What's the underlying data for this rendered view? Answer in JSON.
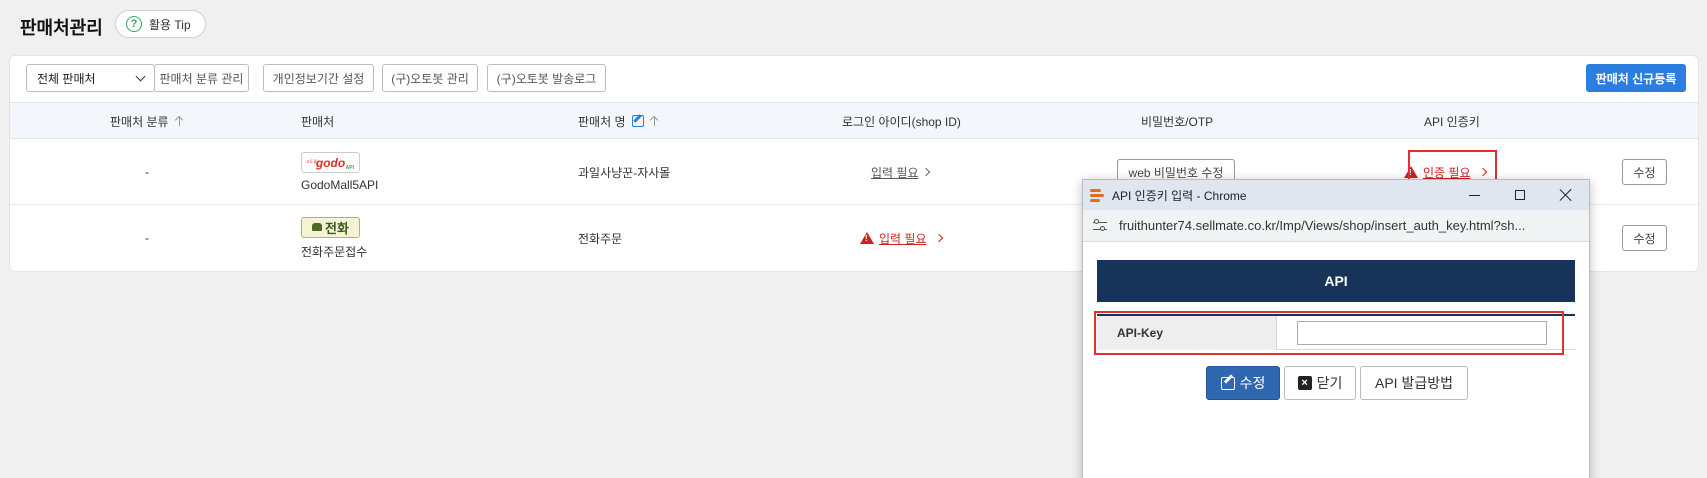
{
  "header": {
    "title": "판매처관리",
    "tip_label": "활용 Tip"
  },
  "toolbar": {
    "select_value": "전체 판매처",
    "buttons": [
      "판매처 분류 관리",
      "개인정보기간 설정",
      "(구)오토봇 관리",
      "(구)오토봇 발송로그"
    ],
    "primary_label": "판매처 신규등록",
    "accent_color": "#2b7de0"
  },
  "table": {
    "headers": {
      "category": "판매처 분류",
      "seller": "판매처",
      "seller_name": "판매처 명",
      "login_id": "로그인 아이디(shop ID)",
      "password": "비밀번호/OTP",
      "api_key": "API 인증키"
    },
    "rows": [
      {
        "category": "-",
        "logo_icon": "godomall-logo",
        "logo_text": "godo",
        "logo_small_left": "고도몰",
        "logo_small_right": "API",
        "seller": "GodoMall5API",
        "seller_name": "과일사냥꾼-자사몰",
        "login_id": "입력 필요",
        "password_btn": "web 비밀번호 수정",
        "api_key": "인증 필요",
        "edit_btn": "수정"
      },
      {
        "category": "-",
        "logo_icon": "phone-order-logo",
        "logo_text": "전화",
        "seller": "전화주문접수",
        "seller_name": "전화주문",
        "login_id": "입력 필요",
        "edit_btn": "수정"
      }
    ]
  },
  "popup": {
    "window_title": "API 인증키 입력 - Chrome",
    "url": "fruithunter74.sellmate.co.kr/Imp/Views/shop/insert_auth_key.html?sh...",
    "header": "API",
    "field_label": "API-Key",
    "field_value": "",
    "buttons": {
      "save": "수정",
      "close": "닫기",
      "howto": "API 발급방법"
    }
  }
}
